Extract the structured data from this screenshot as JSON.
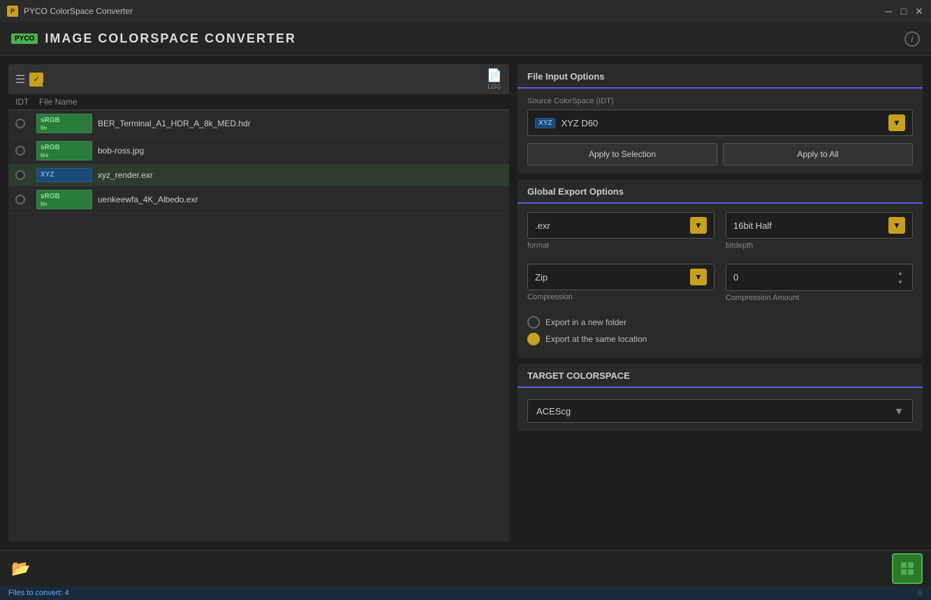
{
  "titleBar": {
    "icon": "P",
    "title": "PYCO ColorSpace Converter",
    "minimizeBtn": "─",
    "maximizeBtn": "□",
    "closeBtn": "✕"
  },
  "appHeader": {
    "logo": "PYCO",
    "title": "IMAGE  COLORSPACE  CONVERTER"
  },
  "fileList": {
    "idtHeader": "IDT",
    "fileNameHeader": "File Name",
    "logLabel": "LOG",
    "files": [
      {
        "id": 0,
        "tag": "sRGB",
        "tagSub": "lin",
        "name": "BER_Terminal_A1_HDR_A_8k_MED.hdr",
        "selected": false
      },
      {
        "id": 1,
        "tag": "sRGB",
        "tagSub": "tex",
        "name": "bob-ross.jpg",
        "selected": false
      },
      {
        "id": 2,
        "tag": "XYZ",
        "tagSub": "",
        "name": "xyz_render.exr",
        "selected": false
      },
      {
        "id": 3,
        "tag": "sRGB",
        "tagSub": "lin",
        "name": "uenkeewfa_4K_Albedo.exr",
        "selected": false
      }
    ]
  },
  "fileInputOptions": {
    "sectionTitle": "File Input Options",
    "sourceLabel": "Source ColorSpace (IDT)",
    "sourceTag": "XYZ",
    "sourceValue": "XYZ D60",
    "applySelectionLabel": "Apply to Selection",
    "applyAllLabel": "Apply to All"
  },
  "globalExportOptions": {
    "sectionTitle": "Global Export Options",
    "formatValue": ".exr",
    "formatLabel": "format",
    "bitdepthValue": "16bit Half",
    "bitdepthLabel": "bitdepth",
    "compressionValue": "Zip",
    "compressionLabel": "Compression",
    "compressionAmountValue": "0",
    "compressionAmountLabel": "Compression Amount",
    "exportNewFolderLabel": "Export in a new folder",
    "exportSameLocationLabel": "Export at the same location"
  },
  "targetColorspace": {
    "sectionTitle": "TARGET COLORSPACE",
    "value": "ACEScg"
  },
  "bottomBar": {
    "statusText": "Files to convert: 4",
    "statusRight": "⠿"
  }
}
